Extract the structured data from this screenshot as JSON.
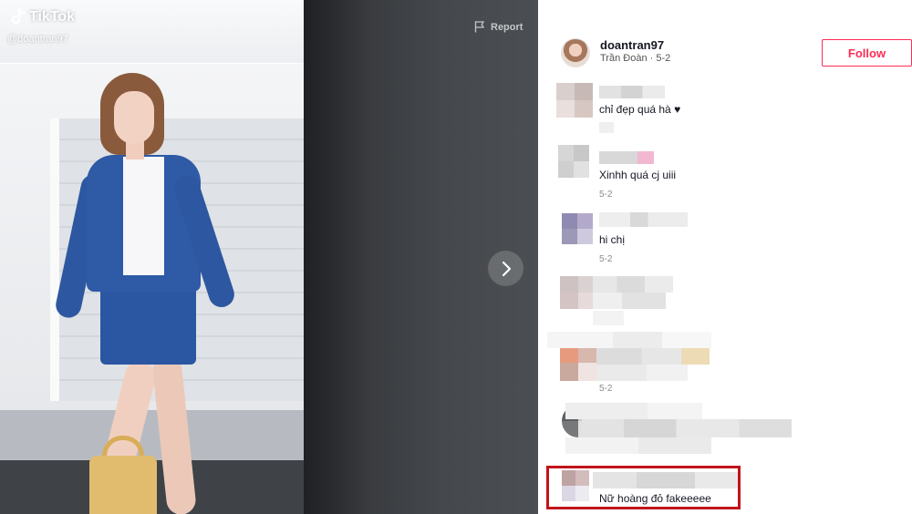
{
  "video": {
    "app_name": "TikTok",
    "handle": "@doantran97",
    "report_label": "Report"
  },
  "author": {
    "username": "doantran97",
    "display_line": "Trần Đoàn · 5-2",
    "follow_label": "Follow"
  },
  "comments": [
    {
      "text": "chỉ đẹp quá hà ♥",
      "date": ""
    },
    {
      "text": "Xinhh quá cj uiii",
      "date": "5-2"
    },
    {
      "text": "hi chị",
      "date": "5-2"
    },
    {
      "text": "",
      "date": ""
    },
    {
      "text": "",
      "date": "5-2"
    },
    {
      "text": "",
      "date": ""
    },
    {
      "text": "Nữ hoàng đỏ fakeeeee",
      "date": ""
    }
  ],
  "colors": {
    "accent": "#fe2c55",
    "highlight": "#c1141b"
  },
  "icons": {
    "logo": "tiktok-note-icon",
    "report": "flag-icon",
    "next": "chevron-right-icon"
  }
}
